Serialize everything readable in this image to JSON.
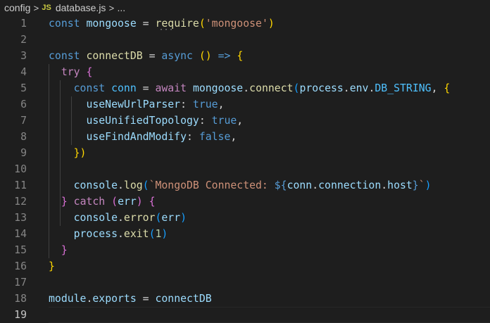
{
  "breadcrumb": {
    "folder": "config",
    "separator": ">",
    "file_icon": "JS",
    "file": "database.js",
    "ellipsis": "..."
  },
  "editor": {
    "active_line": 19,
    "lines": [
      {
        "n": "1",
        "tokens": [
          [
            "k-blue",
            "const"
          ],
          [
            "k-op",
            " "
          ],
          [
            "k-var",
            "mongoose"
          ],
          [
            "k-op",
            " = "
          ],
          [
            "k-fn",
            "require"
          ],
          [
            "k-b1",
            "("
          ],
          [
            "k-str",
            "'mongoose'"
          ],
          [
            "k-b1",
            ")"
          ]
        ]
      },
      {
        "n": "2",
        "tokens": []
      },
      {
        "n": "3",
        "tokens": [
          [
            "k-blue",
            "const"
          ],
          [
            "k-op",
            " "
          ],
          [
            "k-fn",
            "connectDB"
          ],
          [
            "k-op",
            " = "
          ],
          [
            "k-blue",
            "async"
          ],
          [
            "k-op",
            " "
          ],
          [
            "k-b1",
            "()"
          ],
          [
            "k-op",
            " "
          ],
          [
            "k-blue",
            "=>"
          ],
          [
            "k-op",
            " "
          ],
          [
            "k-b1",
            "{"
          ]
        ]
      },
      {
        "n": "4",
        "tokens": [
          [
            "k-op",
            "  "
          ],
          [
            "k-purple",
            "try"
          ],
          [
            "k-op",
            " "
          ],
          [
            "k-b2",
            "{"
          ]
        ]
      },
      {
        "n": "5",
        "tokens": [
          [
            "k-op",
            "    "
          ],
          [
            "k-blue",
            "const"
          ],
          [
            "k-op",
            " "
          ],
          [
            "k-const",
            "conn"
          ],
          [
            "k-op",
            " = "
          ],
          [
            "k-purple",
            "await"
          ],
          [
            "k-op",
            " "
          ],
          [
            "k-var",
            "mongoose"
          ],
          [
            "k-op",
            "."
          ],
          [
            "k-fn",
            "connect"
          ],
          [
            "k-b3",
            "("
          ],
          [
            "k-var",
            "process"
          ],
          [
            "k-op",
            "."
          ],
          [
            "k-var",
            "env"
          ],
          [
            "k-op",
            "."
          ],
          [
            "k-const",
            "DB_STRING"
          ],
          [
            "k-op",
            ", "
          ],
          [
            "k-b1",
            "{"
          ]
        ]
      },
      {
        "n": "6",
        "tokens": [
          [
            "k-op",
            "      "
          ],
          [
            "k-var",
            "useNewUrlParser"
          ],
          [
            "k-op",
            ": "
          ],
          [
            "k-blue",
            "true"
          ],
          [
            "k-op",
            ","
          ]
        ]
      },
      {
        "n": "7",
        "tokens": [
          [
            "k-op",
            "      "
          ],
          [
            "k-var",
            "useUnifiedTopology"
          ],
          [
            "k-op",
            ": "
          ],
          [
            "k-blue",
            "true"
          ],
          [
            "k-op",
            ","
          ]
        ]
      },
      {
        "n": "8",
        "tokens": [
          [
            "k-op",
            "      "
          ],
          [
            "k-var",
            "useFindAndModify"
          ],
          [
            "k-op",
            ": "
          ],
          [
            "k-blue",
            "false"
          ],
          [
            "k-op",
            ","
          ]
        ]
      },
      {
        "n": "9",
        "tokens": [
          [
            "k-op",
            "    "
          ],
          [
            "k-b1",
            "})"
          ]
        ]
      },
      {
        "n": "10",
        "tokens": []
      },
      {
        "n": "11",
        "tokens": [
          [
            "k-op",
            "    "
          ],
          [
            "k-var",
            "console"
          ],
          [
            "k-op",
            "."
          ],
          [
            "k-fn",
            "log"
          ],
          [
            "k-b3",
            "("
          ],
          [
            "k-str",
            "`MongoDB Connected: "
          ],
          [
            "k-blue",
            "${"
          ],
          [
            "k-var",
            "conn"
          ],
          [
            "k-op",
            "."
          ],
          [
            "k-var",
            "connection"
          ],
          [
            "k-op",
            "."
          ],
          [
            "k-var",
            "host"
          ],
          [
            "k-blue",
            "}"
          ],
          [
            "k-str",
            "`"
          ],
          [
            "k-b3",
            ")"
          ]
        ]
      },
      {
        "n": "12",
        "tokens": [
          [
            "k-op",
            "  "
          ],
          [
            "k-b2",
            "}"
          ],
          [
            "k-op",
            " "
          ],
          [
            "k-purple",
            "catch"
          ],
          [
            "k-op",
            " "
          ],
          [
            "k-b2",
            "("
          ],
          [
            "k-var",
            "err"
          ],
          [
            "k-b2",
            ")"
          ],
          [
            "k-op",
            " "
          ],
          [
            "k-b2",
            "{"
          ]
        ]
      },
      {
        "n": "13",
        "tokens": [
          [
            "k-op",
            "    "
          ],
          [
            "k-var",
            "console"
          ],
          [
            "k-op",
            "."
          ],
          [
            "k-fn",
            "error"
          ],
          [
            "k-b3",
            "("
          ],
          [
            "k-var",
            "err"
          ],
          [
            "k-b3",
            ")"
          ]
        ]
      },
      {
        "n": "14",
        "tokens": [
          [
            "k-op",
            "    "
          ],
          [
            "k-var",
            "process"
          ],
          [
            "k-op",
            "."
          ],
          [
            "k-fn",
            "exit"
          ],
          [
            "k-b3",
            "("
          ],
          [
            "k-num",
            "1"
          ],
          [
            "k-b3",
            ")"
          ]
        ]
      },
      {
        "n": "15",
        "tokens": [
          [
            "k-op",
            "  "
          ],
          [
            "k-b2",
            "}"
          ]
        ]
      },
      {
        "n": "16",
        "tokens": [
          [
            "k-b1",
            "}"
          ]
        ]
      },
      {
        "n": "17",
        "tokens": []
      },
      {
        "n": "18",
        "tokens": [
          [
            "k-var",
            "module"
          ],
          [
            "k-op",
            "."
          ],
          [
            "k-var",
            "exports"
          ],
          [
            "k-op",
            " = "
          ],
          [
            "k-var",
            "connectDB"
          ]
        ]
      },
      {
        "n": "19",
        "tokens": []
      }
    ]
  }
}
